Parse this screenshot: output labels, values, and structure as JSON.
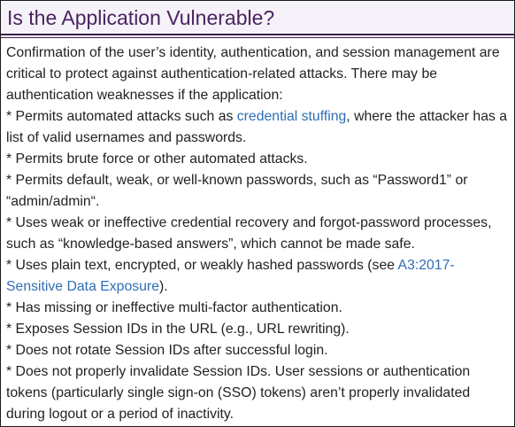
{
  "heading": "Is the Application Vulnerable?",
  "intro": "Confirmation of the user’s identity, authentication, and session management are critical to protect against authentication-related attacks. There may be authentication weaknesses if the application:",
  "items": [
    {
      "before": "* Permits automated attacks such as ",
      "link": "credential stuffing",
      "after": ", where the attacker has a list of valid usernames and passwords."
    },
    {
      "text": "* Permits brute force or other automated attacks."
    },
    {
      "text": "* Permits default, weak, or well-known passwords, such as “Password1” or “admin/admin“."
    },
    {
      "text": "* Uses weak or ineffective credential recovery and forgot-password processes, such as “knowledge-based answers”, which cannot be made safe."
    },
    {
      "before": "* Uses plain text, encrypted, or weakly hashed passwords (see ",
      "link": "A3:2017-Sensitive Data Exposure",
      "after": ")."
    },
    {
      "text": "* Has missing or ineffective multi-factor authentication."
    },
    {
      "text": "* Exposes Session IDs in the URL (e.g., URL rewriting)."
    },
    {
      "text": "* Does not rotate Session IDs after successful login."
    },
    {
      "text": "* Does not properly invalidate Session IDs. User sessions or authentication tokens (particularly single sign-on (SSO) tokens) aren’t properly invalidated during logout or a period of inactivity."
    }
  ],
  "colors": {
    "heading": "#4a235e",
    "link": "#2f6eb5",
    "header_bg": "#f6f2f9",
    "rule": "#3b1f4f"
  }
}
